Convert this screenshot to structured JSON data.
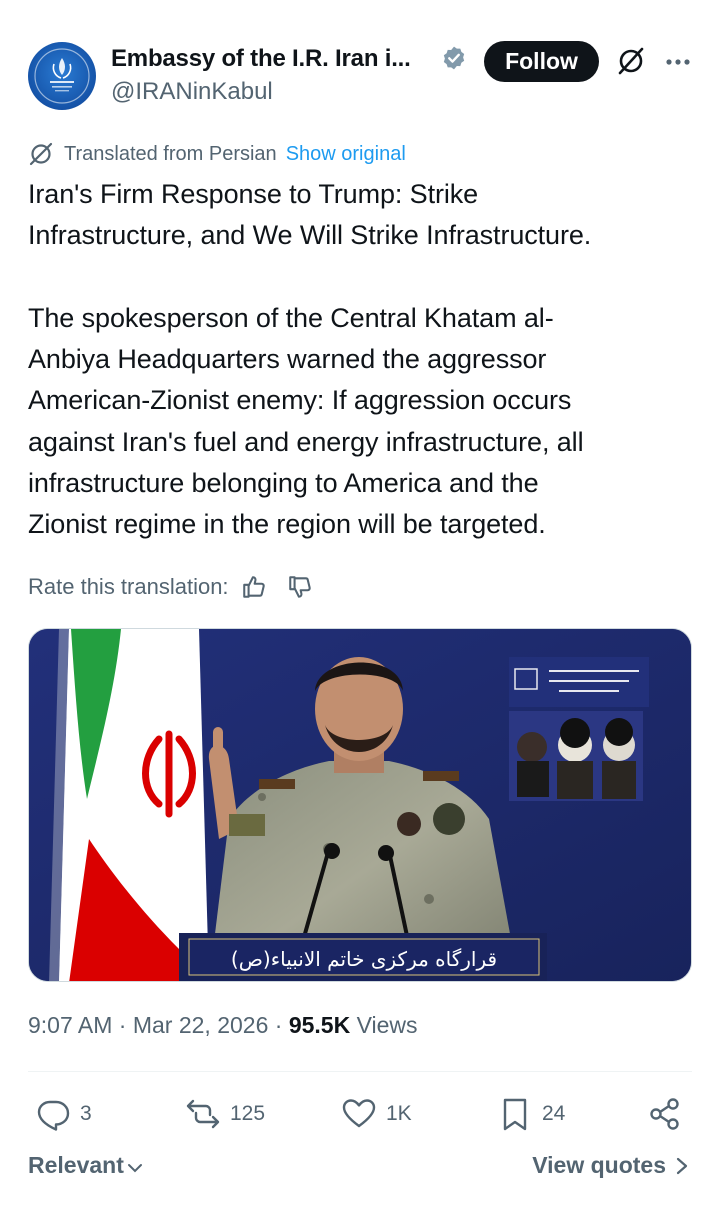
{
  "author": {
    "name": "Embassy of the I.R. Iran i...",
    "handle": "@IRANinKabul",
    "avatar_icon": "iran-emblem-logo",
    "verified_icon": "verified-badge-icon",
    "avatar_color": "#1553a8"
  },
  "header_actions": {
    "follow_label": "Follow",
    "grok_icon": "grok-icon",
    "more_icon": "more-dots-icon"
  },
  "translation": {
    "label": "Translated from Persian",
    "show_original": "Show original",
    "icon": "translate-icon"
  },
  "tweet": {
    "text": "Iran's Firm Response to Trump: Strike\nInfrastructure, and We Will Strike Infrastructure.\n\nThe spokesperson of the Central Khatam al-\nAnbiya Headquarters warned the aggressor\nAmerican-Zionist enemy: If aggression occurs\nagainst Iran's fuel and energy infrastructure, all\ninfrastructure belonging to America and the\nZionist regime in the region will be targeted."
  },
  "rate": {
    "label": "Rate this translation:",
    "up_icon": "thumbs-up-icon",
    "down_icon": "thumbs-down-icon"
  },
  "media": {
    "podium_text": "قرارگاه مرکزی خاتم الانبیاء(ص)",
    "background_color": "#1e2a6b"
  },
  "meta": {
    "time": "9:07 AM",
    "sep1": " · ",
    "date": "Mar 22, 2026",
    "sep2": " · ",
    "views_count": "95.5K",
    "views_label": " Views"
  },
  "actions": {
    "replies": "3",
    "reposts": "125",
    "likes": "1K",
    "bookmarks": "24",
    "reply_icon": "reply-icon",
    "repost_icon": "repost-icon",
    "like_icon": "heart-icon",
    "bookmark_icon": "bookmark-icon",
    "share_icon": "share-icon"
  },
  "footer": {
    "relevant": "Relevant",
    "view_quotes": "View quotes"
  },
  "colors": {
    "text": "#0f1419",
    "secondary": "#536471",
    "link": "#1d9bf0",
    "verified": "#829aab"
  }
}
